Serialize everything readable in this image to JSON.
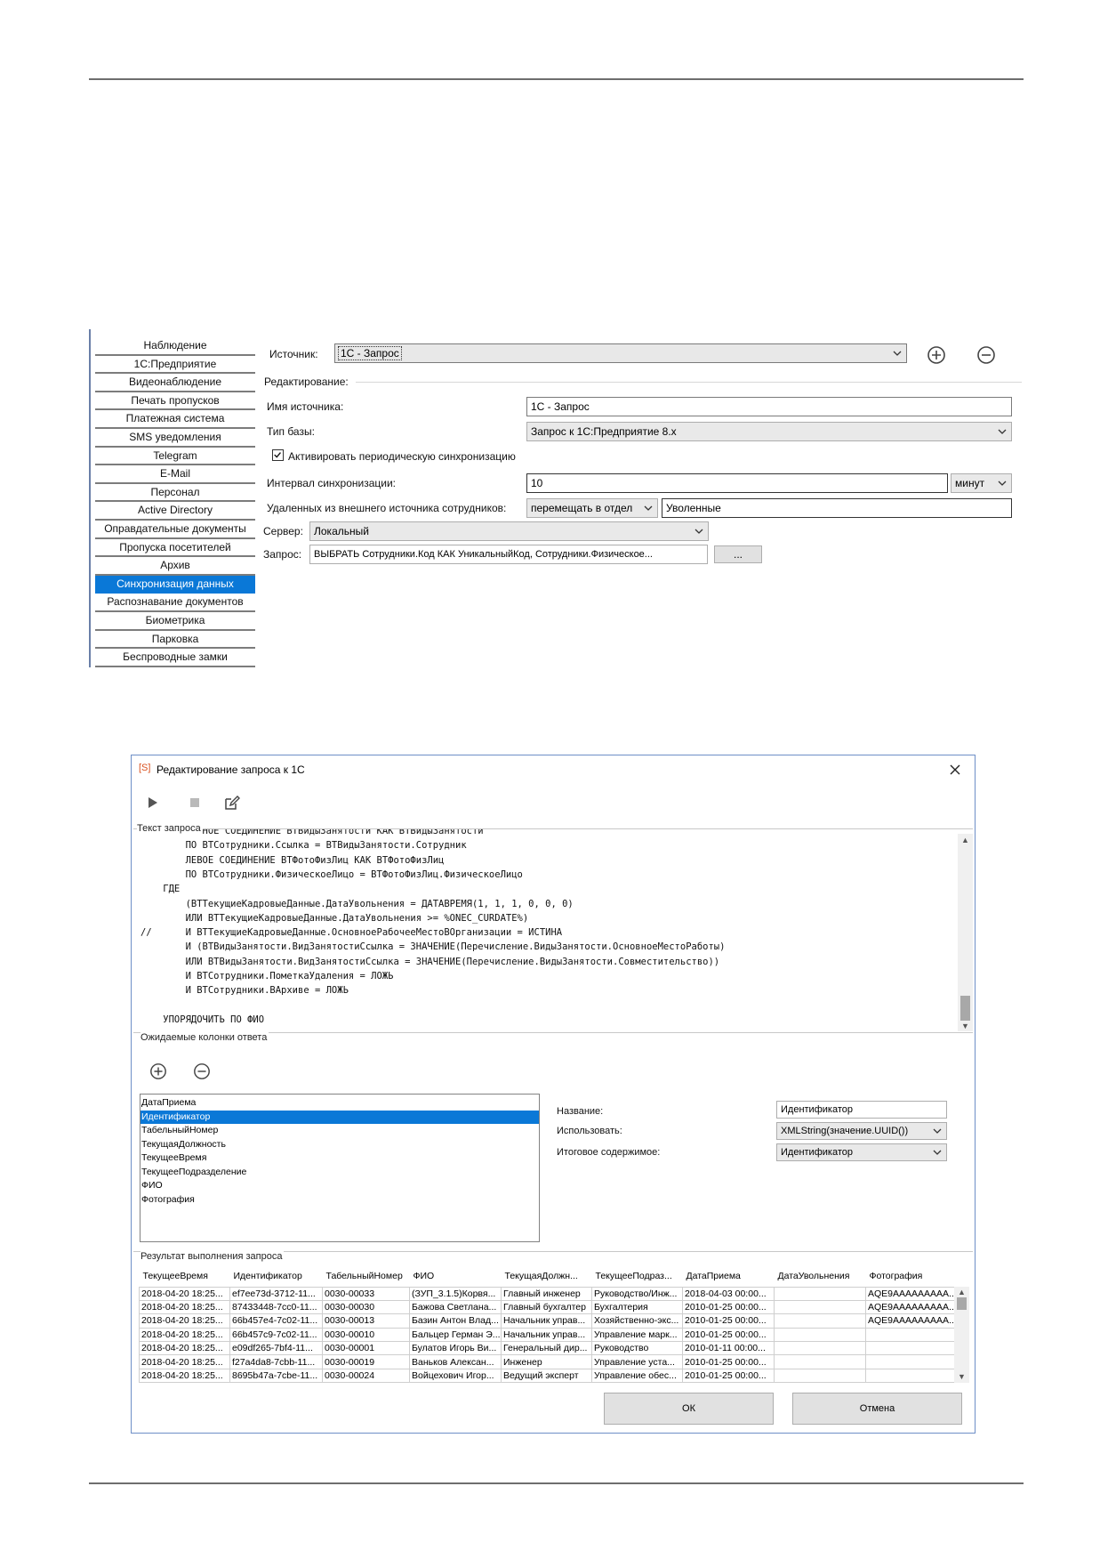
{
  "settings": {
    "menu": [
      {
        "label": "Наблюдение",
        "active": false
      },
      {
        "label": "1С:Предприятие",
        "active": false
      },
      {
        "label": "Видеонаблюдение",
        "active": false
      },
      {
        "label": "Печать пропусков",
        "active": false
      },
      {
        "label": "Платежная система",
        "active": false
      },
      {
        "label": "SMS уведомления",
        "active": false
      },
      {
        "label": "Telegram",
        "active": false
      },
      {
        "label": "E-Mail",
        "active": false
      },
      {
        "label": "Персонал",
        "active": false
      },
      {
        "label": "Active Directory",
        "active": false
      },
      {
        "label": "Оправдательные документы",
        "active": false
      },
      {
        "label": "Пропуска посетителей",
        "active": false
      },
      {
        "label": "Архив",
        "active": false
      },
      {
        "label": "Синхронизация данных",
        "active": true
      },
      {
        "label": "Распознавание документов",
        "active": false
      },
      {
        "label": "Биометрика",
        "active": false
      },
      {
        "label": "Парковка",
        "active": false
      },
      {
        "label": "Беспроводные замки",
        "active": false
      }
    ],
    "source_label": "Источник:",
    "source_value": "1С - Запрос",
    "editing_label": "Редактирование:",
    "name_label": "Имя источника:",
    "name_value": "1С - Запрос",
    "base_type_label": "Тип базы:",
    "base_type_value": "Запрос к 1С:Предприятие 8.х",
    "sync_checkbox_label": "Активировать периодическую синхронизацию",
    "sync_checked": true,
    "interval_label": "Интервал синхронизации:",
    "interval_value": "10",
    "interval_unit": "минут",
    "deleted_label": "Удаленных из внешнего источника сотрудников:",
    "deleted_action": "перемещать в отдел",
    "deleted_dept": "Уволенные",
    "server_label": "Сервер:",
    "server_value": "Локальный",
    "query_label": "Запрос:",
    "query_value": "ВЫБРАТЬ  Сотрудники.Код КАК УникальныйКод,  Сотрудники.Физическое...",
    "query_button": "..."
  },
  "dialog": {
    "title": "Редактирование запроса к 1С",
    "app_icon_text": "[S]",
    "query_text_label": "Текст запроса",
    "code_lines": [
      "        ПОЛНОЕ СОЕДИНЕНИЕ ВТВидыЗанятости КАК ВТВидыЗанятости",
      "        ПО ВТСотрудники.Ссылка = ВТВидыЗанятости.Сотрудник",
      "        ЛЕВОЕ СОЕДИНЕНИЕ ВТФотоФизЛиц КАК ВТФотоФизЛиц",
      "        ПО ВТСотрудники.ФизическоеЛицо = ВТФотоФизЛиц.ФизическоеЛицо",
      "    ГДЕ",
      "        (ВТТекущиеКадровыеДанные.ДатаУвольнения = ДАТАВРЕМЯ(1, 1, 1, 0, 0, 0)",
      "        ИЛИ ВТТекущиеКадровыеДанные.ДатаУвольнения >= %ONEC_CURDATE%)",
      "//      И ВТТекущиеКадровыеДанные.ОсновноеРабочееМестоВОрганизации = ИСТИНА",
      "        И (ВТВидыЗанятости.ВидЗанятостиСсылка = ЗНАЧЕНИЕ(Перечисление.ВидыЗанятости.ОсновноеМестоРаботы)",
      "        ИЛИ ВТВидыЗанятости.ВидЗанятостиСсылка = ЗНАЧЕНИЕ(Перечисление.ВидыЗанятости.Совместительство))",
      "        И ВТСотрудники.ПометкаУдаления = ЛОЖЬ",
      "        И ВТСотрудники.ВАрхиве = ЛОЖЬ",
      "",
      "    УПОРЯДОЧИТЬ ПО ФИО"
    ],
    "expected_columns_label": "Ожидаемые колонки ответа",
    "columns": [
      {
        "label": "ДатаПриема",
        "active": false
      },
      {
        "label": "Идентификатор",
        "active": true
      },
      {
        "label": "ТабельныйНомер",
        "active": false
      },
      {
        "label": "ТекущаяДолжность",
        "active": false
      },
      {
        "label": "ТекущееВремя",
        "active": false
      },
      {
        "label": "ТекущееПодразделение",
        "active": false
      },
      {
        "label": "ФИО",
        "active": false
      },
      {
        "label": "Фотография",
        "active": false
      }
    ],
    "prop_name_label": "Название:",
    "prop_name_value": "Идентификатор",
    "prop_use_label": "Использовать:",
    "prop_use_value": "XMLString(значение.UUID())",
    "prop_final_label": "Итоговое содержимое:",
    "prop_final_value": "Идентификатор",
    "result_label": "Результат выполнения запроса",
    "result_headers": [
      "ТекущееВремя",
      "Идентификатор",
      "ТабельныйНомер",
      "ФИО",
      "ТекущаяДолжн...",
      "ТекущееПодраз...",
      "ДатаПриема",
      "ДатаУвольнения",
      "Фотография"
    ],
    "result_rows": [
      [
        "2018-04-20 18:25...",
        "ef7ee73d-3712-11...",
        "0030-00033",
        "(ЗУП_3.1.5)Корвя...",
        "Главный инженер",
        "Руководство/Инж...",
        "2018-04-03 00:00...",
        "",
        "AQE9AAAAAAAAA..."
      ],
      [
        "2018-04-20 18:25...",
        "87433448-7cc0-11...",
        "0030-00030",
        "Бажова Светлана...",
        "Главный бухгалтер",
        "Бухгалтерия",
        "2010-01-25 00:00...",
        "",
        "AQE9AAAAAAAAA..."
      ],
      [
        "2018-04-20 18:25...",
        "66b457e4-7c02-11...",
        "0030-00013",
        "Базин Антон Влад...",
        "Начальник управ...",
        "Хозяйственно-экс...",
        "2010-01-25 00:00...",
        "",
        "AQE9AAAAAAAAA..."
      ],
      [
        "2018-04-20 18:25...",
        "66b457c9-7c02-11...",
        "0030-00010",
        "Бальцер Герман Э...",
        "Начальник управ...",
        "Управление марк...",
        "2010-01-25 00:00...",
        "",
        ""
      ],
      [
        "2018-04-20 18:25...",
        "e09df265-7bf4-11...",
        "0030-00001",
        "Булатов Игорь Ви...",
        "Генеральный дир...",
        "Руководство",
        "2010-01-11 00:00...",
        "",
        ""
      ],
      [
        "2018-04-20 18:25...",
        "f27a4da8-7cbb-11...",
        "0030-00019",
        "Ваньков Алексан...",
        "Инженер",
        "Управление уста...",
        "2010-01-25 00:00...",
        "",
        ""
      ],
      [
        "2018-04-20 18:25...",
        "8695b47a-7cbe-11...",
        "0030-00024",
        "Войцехович Игор...",
        "Ведущий эксперт",
        "Управление обес...",
        "2010-01-25 00:00...",
        "",
        ""
      ]
    ],
    "ok_button": "ОК",
    "cancel_button": "Отмена"
  }
}
